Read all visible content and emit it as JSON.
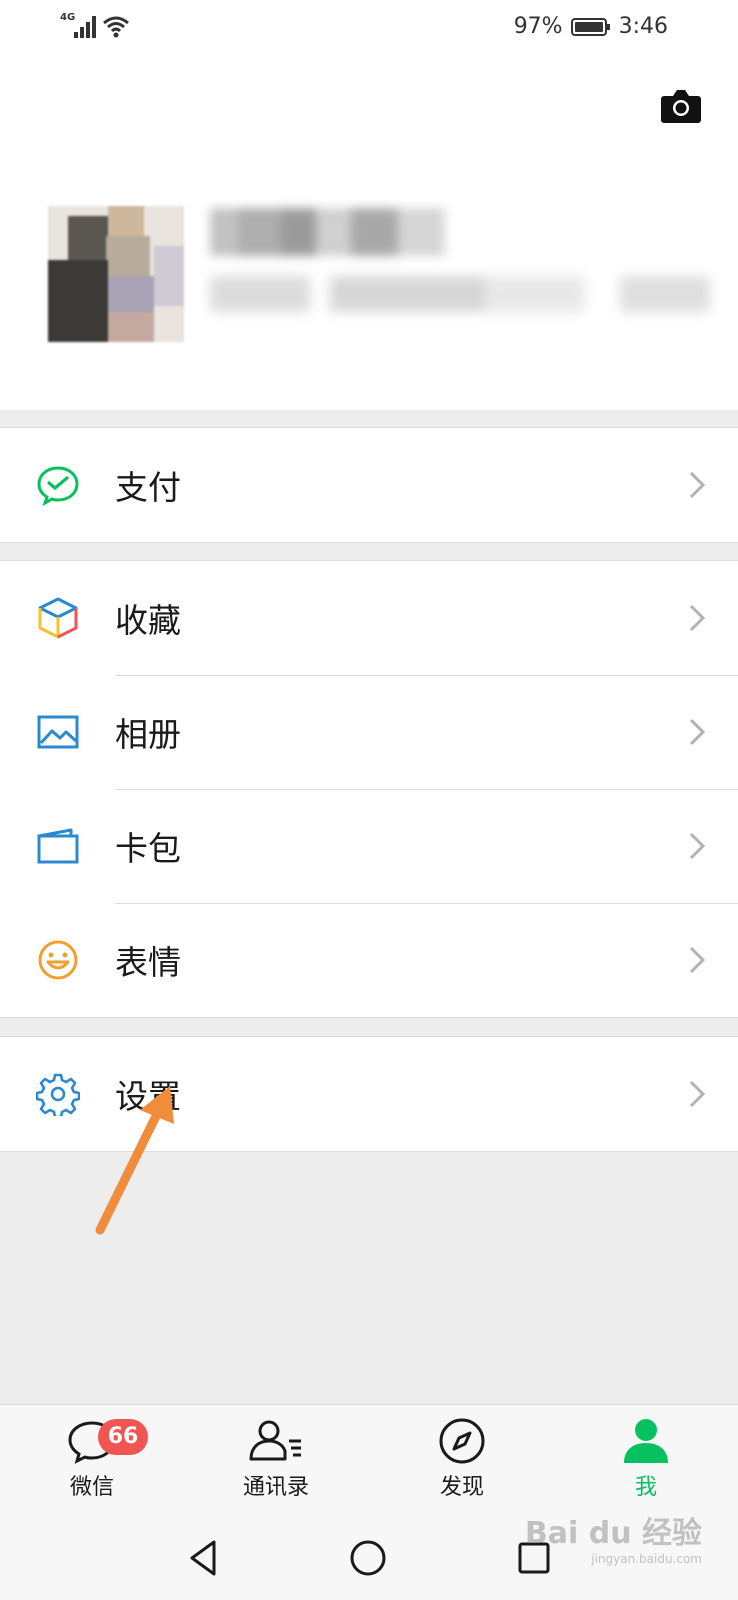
{
  "status": {
    "network": "4G",
    "battery": "97%",
    "time": "3:46"
  },
  "profile": {
    "camera_icon": "camera-icon"
  },
  "menu": {
    "pay": {
      "label": "支付",
      "icon": "wechat-pay-icon",
      "color": "#07c160"
    },
    "favorites": {
      "label": "收藏",
      "icon": "cube-icon"
    },
    "album": {
      "label": "相册",
      "icon": "picture-icon",
      "color": "#2a8ad0"
    },
    "cards": {
      "label": "卡包",
      "icon": "card-wallet-icon",
      "color": "#2a8ad0"
    },
    "stickers": {
      "label": "表情",
      "icon": "smiley-icon",
      "color": "#f0a030"
    },
    "settings": {
      "label": "设置",
      "icon": "gear-icon",
      "color": "#2a8ad0"
    }
  },
  "tabs": [
    {
      "label": "微信",
      "icon": "chat-icon",
      "badge": "66"
    },
    {
      "label": "通讯录",
      "icon": "contacts-icon"
    },
    {
      "label": "发现",
      "icon": "compass-icon"
    },
    {
      "label": "我",
      "icon": "person-icon",
      "active": true
    }
  ],
  "annotation": {
    "arrow_color": "#f08c3c"
  },
  "watermark": {
    "text": "Bai du 经验",
    "sub": "jingyan.baidu.com"
  },
  "accent": "#07c160"
}
